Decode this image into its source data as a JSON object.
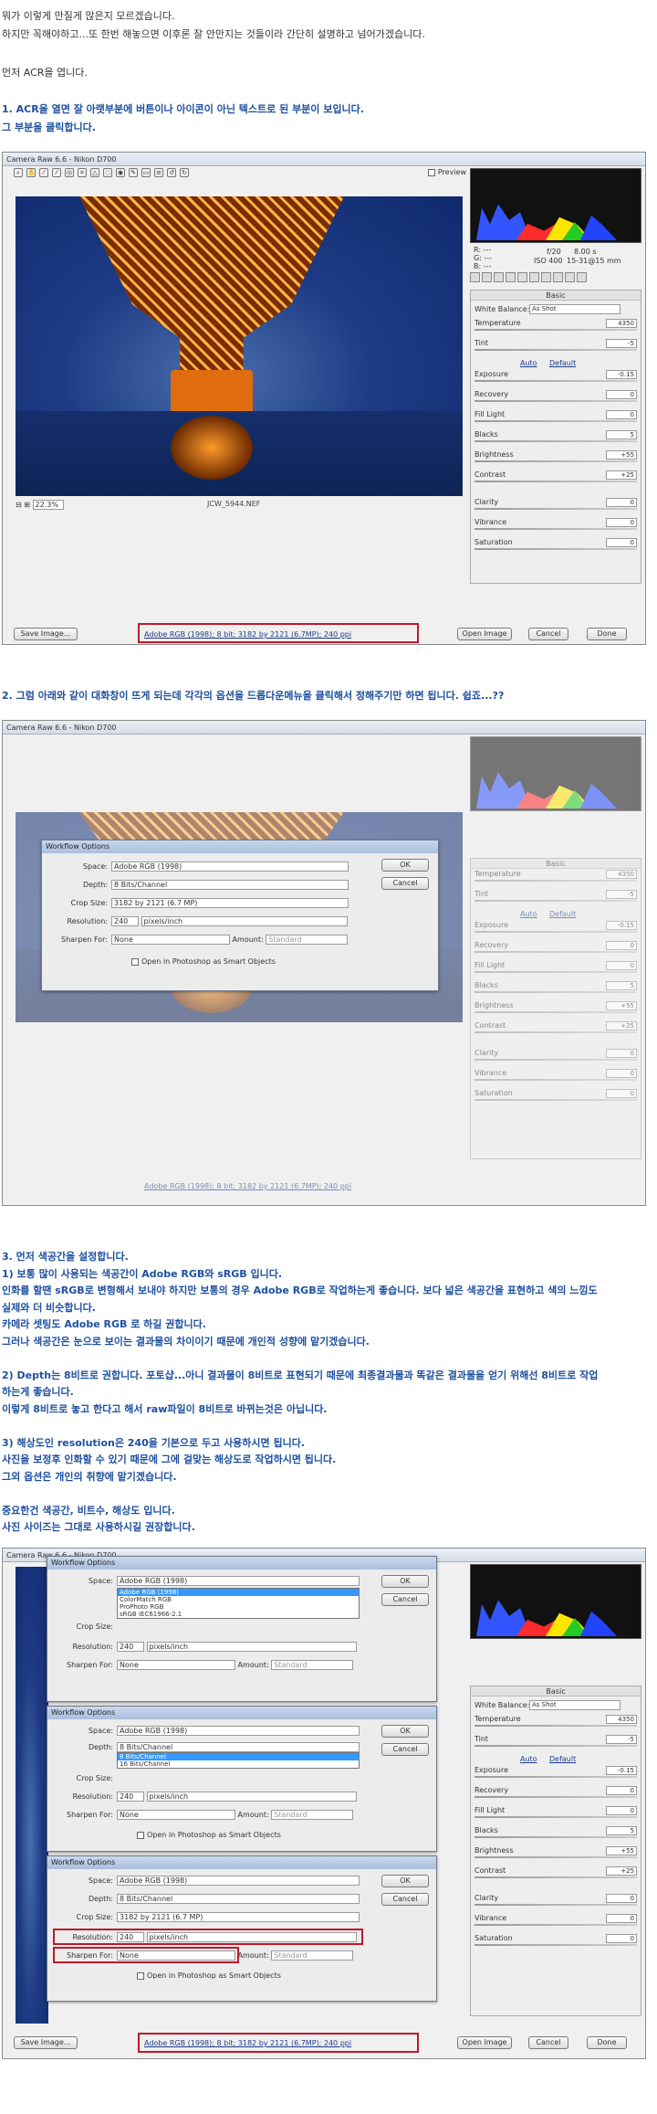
{
  "intro": {
    "line1": "뭐가 이렇게 만질게 많은지 모르겠습니다.",
    "line2": "하지만 꼭해야하고...또 한번 해놓으면 이후론 잘 안만지는 것들이라 간단히 설명하고 넘어가겠습니다.",
    "line3": "먼저 ACR을 엽니다."
  },
  "step1": {
    "line1": "1. ACR을 열면 잘 아랫부분에 버튼이나 아이콘이 아닌 텍스트로 된 부분이 보입니다.",
    "line2": "그 부분을 클릭합니다."
  },
  "step2": {
    "line1": "2. 그럼 아래와 같이 대화창이 뜨게 되는데 각각의 옵션을 드롭다운메뉴을 클릭해서 정해주기만 하면 됩니다. 쉽죠...??"
  },
  "step3": {
    "lines": [
      "3. 먼저 색공간을 설정합니다.",
      "1) 보통 많이 사용되는 색공간이 Adobe RGB와 sRGB 입니다.",
      "인화를 할땐 sRGB로 변형해서 보내야 하지만 보통의 경우 Adobe RGB로 작업하는게 좋습니다. 보다 넓은 색공간을 표현하고 색의 느낌도",
      "실제와 더 비슷합니다.",
      "카메라 셋팅도 Adobe RGB 로 하길 권합니다.",
      "그러나 색공간은 눈으로 보이는 결과물의 차이이기 때문에 개인적 성향에 맡기겠습니다.",
      "",
      "2) Depth는 8비트로 권합니다. 포토샵...아니 결과물이 8비트로 표현되기 때문에 최종결과물과 똑같은 결과물을 얻기 위해선 8비트로 작업",
      "하는게 좋습니다.",
      "이렇게 8비트로 놓고 한다고 해서 raw파일이 8비트로 바뀌는것은 아닙니다.",
      "",
      "3) 해상도인 resolution은 240을 기본으로 두고 사용하시면 됩니다.",
      "사진을 보정후 인화할 수 있기 때문에 그에 걸맞는 해상도로 작업하시면 됩니다.",
      "그외 옵션은 개인의 취향에 맡기겠습니다.",
      "",
      "중요한건 색공간, 비트수, 해상도 입니다.",
      "사진 사이즈는 그대로 사용하시길 권장합니다."
    ]
  },
  "acr": {
    "title": "Camera Raw 6.6  -  Nikon D700",
    "preview_label": "Preview",
    "zoom": "22.3%",
    "filename": "JCW_5944.NEF",
    "workflow_link": "Adobe RGB (1998); 8 bit; 3182 by 2121 (6.7MP); 240 ppi",
    "save_image": "Save Image...",
    "open_image": "Open Image",
    "cancel": "Cancel",
    "done": "Done",
    "rgb_r": "R:   ---",
    "rgb_g": "G:   ---",
    "rgb_b": "B:   ---",
    "aperture": "f/20",
    "shutter": "8.00 s",
    "iso": "ISO 400",
    "lens": "15-31@15 mm",
    "panel_title": "Basic",
    "wb_label": "White Balance:",
    "wb_value": "As Shot",
    "auto": "Auto",
    "default": "Default",
    "sliders": [
      {
        "label": "Temperature",
        "value": "4350"
      },
      {
        "label": "Tint",
        "value": "-5"
      },
      {
        "label": "Exposure",
        "value": "-0.15"
      },
      {
        "label": "Recovery",
        "value": "0"
      },
      {
        "label": "Fill Light",
        "value": "0"
      },
      {
        "label": "Blacks",
        "value": "5"
      },
      {
        "label": "Brightness",
        "value": "+55"
      },
      {
        "label": "Contrast",
        "value": "+25"
      },
      {
        "label": "Clarity",
        "value": "0"
      },
      {
        "label": "Vibrance",
        "value": "0"
      },
      {
        "label": "Saturation",
        "value": "0"
      }
    ]
  },
  "workflow": {
    "title": "Workflow Options",
    "space_label": "Space:",
    "space_value": "Adobe RGB (1998)",
    "depth_label": "Depth:",
    "depth_value": "8 Bits/Channel",
    "crop_label": "Crop Size:",
    "crop_value": "3182 by 2121  (6.7 MP)",
    "res_label": "Resolution:",
    "res_value": "240",
    "res_unit": "pixels/inch",
    "sharpen_label": "Sharpen For:",
    "sharpen_value": "None",
    "amount_label": "Amount:",
    "amount_value": "Standard",
    "smart_objects": "Open in Photoshop as Smart Objects",
    "ok": "OK",
    "cancel": "Cancel",
    "space_options": [
      "Adobe RGB (1998)",
      "ColorMatch RGB",
      "ProPhoto RGB",
      "sRGB IEC61966-2.1"
    ],
    "depth_options": [
      "8 Bits/Channel",
      "16 Bits/Channel"
    ]
  }
}
